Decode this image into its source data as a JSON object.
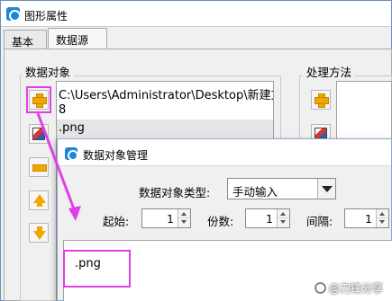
{
  "window": {
    "title": "图形属性"
  },
  "tabs": [
    {
      "label": "基本"
    },
    {
      "label": "数据源"
    }
  ],
  "data_group": {
    "label": "数据对象",
    "items": [
      {
        "text": "C:\\Users\\Administrator\\Desktop\\新建文"
      },
      {
        "text": "8"
      },
      {
        "text": ".png"
      }
    ],
    "selected_index": 2
  },
  "process_group": {
    "label": "处理方法"
  },
  "side_buttons": [
    {
      "icon": "plus-icon"
    },
    {
      "icon": "edit-icon"
    },
    {
      "icon": "minus-icon"
    },
    {
      "icon": "arrow-up-icon"
    },
    {
      "icon": "arrow-down-icon"
    }
  ],
  "process_buttons": [
    {
      "icon": "plus-icon"
    },
    {
      "icon": "edit-icon"
    }
  ],
  "dialog": {
    "title": "数据对象管理",
    "type_label": "数据对象类型:",
    "type_value": "手动输入",
    "start_label": "起始:",
    "start_value": "1",
    "copies_label": "份数:",
    "copies_value": "1",
    "interval_label": "间隔:",
    "interval_value": "1",
    "content_value": ".png"
  },
  "watermark": {
    "text": "@刀锋分享"
  },
  "colors": {
    "highlight": "#e040e6",
    "accent_icon": "#f0a800",
    "app_icon": "#1e86d6"
  }
}
